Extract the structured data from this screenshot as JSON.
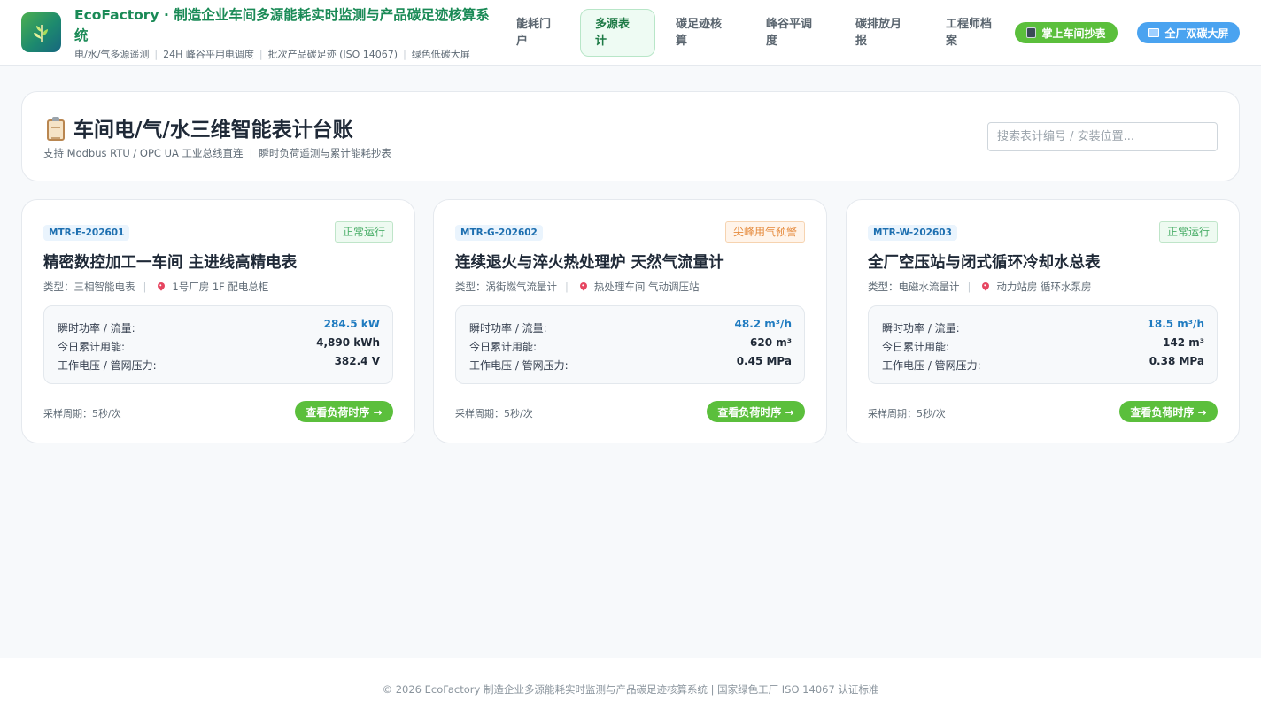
{
  "header": {
    "title": "EcoFactory · 制造企业车间多源能耗实时监测与产品碳足迹核算系统",
    "tags": [
      "电/水/气多源遥测",
      "24H 峰谷平用电调度",
      "批次产品碳足迹 (ISO 14067)",
      "绿色低碳大屏"
    ],
    "logo_icon": "leaf-icon",
    "brand_color": "#1a8a56"
  },
  "nav": {
    "items": [
      {
        "label": "能耗门户",
        "active": false
      },
      {
        "label": "多源表计",
        "active": true
      },
      {
        "label": "碳足迹核算",
        "active": false
      },
      {
        "label": "峰谷平调度",
        "active": false
      },
      {
        "label": "碳排放月报",
        "active": false
      },
      {
        "label": "工程师档案",
        "active": false
      }
    ],
    "mobile_button": {
      "icon": "phone-icon",
      "label": "掌上车间抄表"
    },
    "screen_button": {
      "icon": "monitor-icon",
      "label": "全厂双碳大屏"
    }
  },
  "panel": {
    "icon": "clipboard-icon",
    "title": "车间电/气/水三维智能表计台账",
    "subtitle_parts": [
      "支持 Modbus RTU / OPC UA 工业总线直连",
      "瞬时负荷遥测与累计能耗抄表"
    ],
    "search_placeholder": "搜索表计编号 / 安装位置..."
  },
  "cards": [
    {
      "id": "MTR-E-202601",
      "status": "正常运行",
      "status_level": "ok",
      "title": "精密数控加工一车间 主进线高精电表",
      "type": "类型：三相智能电表",
      "location": "1号厂房 1F 配电总柜",
      "metrics": [
        {
          "label": "瞬时功率 / 流量:",
          "value": "284.5 kW"
        },
        {
          "label": "今日累计用能:",
          "value": "4,890 kWh"
        },
        {
          "label": "工作电压 / 管网压力:",
          "value": "382.4 V"
        }
      ],
      "sample": "采样周期：5秒/次",
      "button": "查看负荷时序 →"
    },
    {
      "id": "MTR-G-202602",
      "status": "尖峰用气预警",
      "status_level": "warn",
      "title": "连续退火与淬火热处理炉 天然气流量计",
      "type": "类型：涡街燃气流量计",
      "location": "热处理车间 气动调压站",
      "metrics": [
        {
          "label": "瞬时功率 / 流量:",
          "value": "48.2 m³/h"
        },
        {
          "label": "今日累计用能:",
          "value": "620 m³"
        },
        {
          "label": "工作电压 / 管网压力:",
          "value": "0.45 MPa"
        }
      ],
      "sample": "采样周期：5秒/次",
      "button": "查看负荷时序 →"
    },
    {
      "id": "MTR-W-202603",
      "status": "正常运行",
      "status_level": "ok",
      "title": "全厂空压站与闭式循环冷却水总表",
      "type": "类型：电磁水流量计",
      "location": "动力站房 循环水泵房",
      "metrics": [
        {
          "label": "瞬时功率 / 流量:",
          "value": "18.5 m³/h"
        },
        {
          "label": "今日累计用能:",
          "value": "142 m³"
        },
        {
          "label": "工作电压 / 管网压力:",
          "value": "0.38 MPa"
        }
      ],
      "sample": "采样周期：5秒/次",
      "button": "查看负荷时序 →"
    }
  ],
  "footer": {
    "text": "© 2026 EcoFactory 制造企业多源能耗实时监测与产品碳足迹核算系统 | 国家绿色工厂 ISO 14067 认证标准"
  }
}
